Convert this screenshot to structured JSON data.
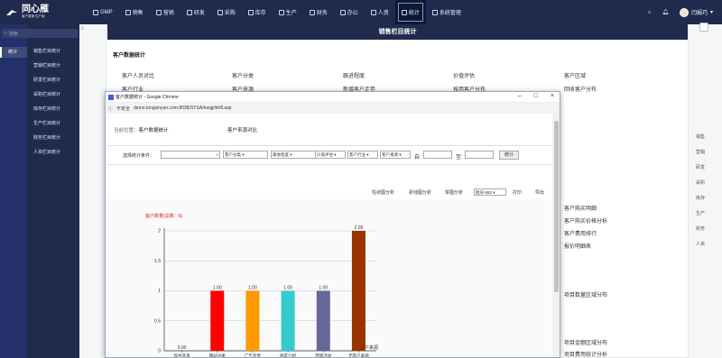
{
  "topbar": {
    "brand": "同心雁",
    "brand_sub": "客户营销·生产版",
    "nav": [
      "GMP",
      "销售",
      "营销",
      "研发",
      "采购",
      "库存",
      "生产",
      "财务",
      "办公",
      "人资",
      "统计",
      "系统管理"
    ],
    "active_index": 10,
    "user": "闫娟巧"
  },
  "sidebar": {
    "search_placeholder": "搜索",
    "current": "统计",
    "items": [
      "销售栏目统计",
      "营销栏目统计",
      "研发栏目统计",
      "采购栏目统计",
      "库存栏目统计",
      "生产栏目统计",
      "财务栏目统计",
      "人资栏目统计"
    ]
  },
  "main": {
    "edge_mark": "E",
    "banner": "销售栏目统计",
    "section": "客户数据统计",
    "links_row1": [
      "客户人员对比",
      "客户分类",
      "跟进程度",
      "价值评估",
      "客户区域"
    ],
    "links_row2": [
      "客户行业",
      "客户来源",
      "新增客户走势",
      "按用客户分布",
      "回收客户分布"
    ],
    "right_links": [
      "客户购买明细",
      "客户购买价格分析",
      "客户费用排行",
      "报价明细表",
      "项目数量区域分布",
      "项目金额区域分布",
      "项目费用统计分析"
    ],
    "right_side": [
      "销售",
      "营销",
      "研发",
      "采购",
      "库存",
      "生产",
      "财务",
      "人资"
    ]
  },
  "popup": {
    "title": "客户数据统计 - Google Chrome",
    "url_warning": "不安全",
    "url": "demo.tongxinyan.com:8038/SYSA/tongji/kh8.asp",
    "crumb_label": "当前位置：",
    "crumb_value": "客户数据统计",
    "tab": "客户来源对比",
    "filter_label": "选择统计条件：",
    "filters": [
      "客户分类",
      "跟进程度",
      "价值评估",
      "客户行业",
      "客户来源"
    ],
    "date_from": "自:",
    "date_to": "至:",
    "stat_button": "统计",
    "toolbar": [
      "柱状图分析",
      "折线图分析",
      "饼图分析",
      "打印",
      "导出"
    ],
    "size_select": "图块-550"
  },
  "chart_data": {
    "type": "bar",
    "title": "客户数量(总数：6)",
    "xlabel": "客户来源",
    "categories": [
      "现住开发",
      "网站注册",
      "广告宣传",
      "朋友介绍",
      "营销活动",
      "无客户来源"
    ],
    "values": [
      0,
      1,
      1,
      1,
      1,
      2
    ],
    "value_labels": [
      "0.00",
      "1.00",
      "1.00",
      "1.00",
      "1.00",
      "2.00"
    ],
    "colors": [
      "#00aaaa",
      "#ff0000",
      "#ff9900",
      "#33cccc",
      "#666699",
      "#993300"
    ],
    "yticks": [
      "0",
      "0.5",
      "1",
      "1.5",
      "2"
    ],
    "ylim": [
      0,
      2
    ]
  }
}
